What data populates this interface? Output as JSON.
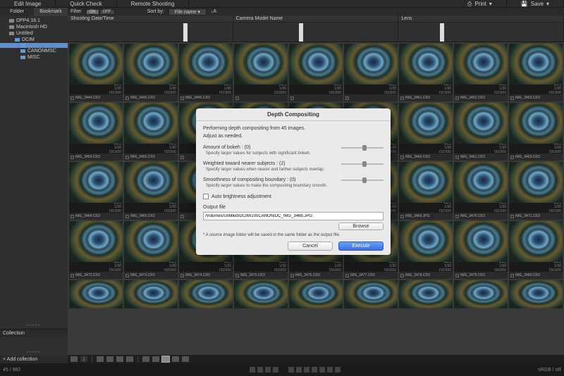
{
  "topbar": {
    "edit": "Edit Image",
    "quick": "Quick Check",
    "remote": "Remote Shooting",
    "print": "Print",
    "save": "Save"
  },
  "sidebar": {
    "tabs": {
      "folder": "Folder",
      "bookmark": "Bookmark"
    },
    "tree": [
      {
        "label": "DPP4.18.1",
        "indent": 8
      },
      {
        "label": "Macintosh HD",
        "indent": 8
      },
      {
        "label": "Untitled",
        "indent": 8
      },
      {
        "label": "DCIM",
        "indent": 16,
        "sel": false
      },
      {
        "label": "",
        "indent": 24,
        "sel": true,
        "blank": true
      },
      {
        "label": "CANONMSC",
        "indent": 24
      },
      {
        "label": "MISC",
        "indent": 24
      }
    ],
    "collection": "Collection",
    "add": "+ Add collection"
  },
  "filter": {
    "label": "Filter",
    "on": "ON",
    "off": "OFF",
    "sortby": "Sort by:",
    "sortval": "File name"
  },
  "cols": {
    "c1": "Shooting Date/Time",
    "c2": "Camera Model Name",
    "c3": "Lens"
  },
  "thumb_meta": {
    "f": "F4.0",
    "s": "1/30",
    "iso": "ISO200",
    "iso100": "ISO100"
  },
  "filenames": {
    "r0": [
      "IMG_3444.CR3",
      "IMG_3445.CR3",
      "IMG_3446.CR3",
      "",
      "",
      "",
      "IMG_3451.CR3",
      "IMG_3452.CR3",
      "IMG_3453.CR3"
    ],
    "r1": [
      "IMG_3454.CR3",
      "IMG_3455.CR3",
      "",
      "",
      "",
      "",
      "IMG_3460.CR3",
      "IMG_3461.CR3",
      "IMG_3463.CR3"
    ],
    "r2": [
      "IMG_3464.CR3",
      "IMG_3465.CR3",
      "",
      "",
      "",
      "",
      "IMG_3469.JPG",
      "IMG_3470.CR3",
      "IMG_3471.CR3"
    ],
    "r3": [
      "IMG_3472.CR3",
      "IMG_3473.CR3",
      "IMG_3474.CR3",
      "IMG_3475.CR3",
      "IMG_3476.CR3",
      "IMG_3477.CR3",
      "IMG_3478.CR3",
      "IMG_3479.CR3",
      "IMG_3480.CR3"
    ]
  },
  "dialog": {
    "title": "Depth Compositing",
    "intro1": "Performing depth compositing from 45 images.",
    "intro2": "Adjust as needed.",
    "bokeh_lbl": "Amount of bokeh : (0)",
    "bokeh_desc": "Specify larger values for subjects with significant bokeh.",
    "weight_lbl": "Weighted toward nearer subjects : (2)",
    "weight_desc": "Specify larger values when nearer and farther subjects overlap.",
    "smooth_lbl": "Smoothness of compositing boundary : (0)",
    "smooth_desc": "Specify larger values to make the compositing boundary smooth.",
    "autobright": "Auto brightness adjustment",
    "output_lbl": "Output file",
    "output_path": "/Volumes/Untitled/DCIM/100CANON/DC_IMG_3468.JPG",
    "browse": "Browse",
    "note": "* A source image folder will be saved in the same folder as the output file.",
    "cancel": "Cancel",
    "execute": "Execute"
  },
  "status": {
    "count": "45 / 982",
    "colorspace": "sRGB / sR"
  }
}
